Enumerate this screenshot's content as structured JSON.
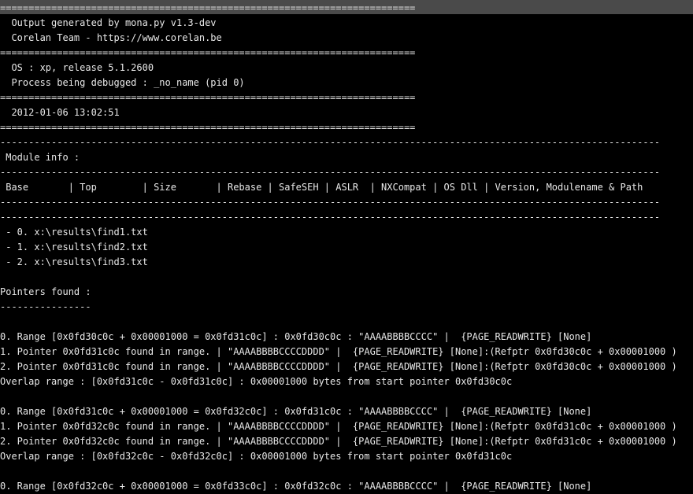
{
  "window": {
    "title": ""
  },
  "console": {
    "lines": [
      "=========================================================================",
      "  Output generated by mona.py v1.3-dev",
      "  Corelan Team - https://www.corelan.be",
      "=========================================================================",
      "  OS : xp, release 5.1.2600",
      "  Process being debugged : _no_name (pid 0)",
      "=========================================================================",
      "  2012-01-06 13:02:51",
      "=========================================================================",
      "--------------------------------------------------------------------------------------------------------------------",
      " Module info :",
      "--------------------------------------------------------------------------------------------------------------------",
      " Base       | Top        | Size       | Rebase | SafeSEH | ASLR  | NXCompat | OS Dll | Version, Modulename & Path",
      "--------------------------------------------------------------------------------------------------------------------",
      "--------------------------------------------------------------------------------------------------------------------",
      " - 0. x:\\results\\find1.txt",
      " - 1. x:\\results\\find2.txt",
      " - 2. x:\\results\\find3.txt",
      "",
      "Pointers found :",
      "----------------",
      "",
      "0. Range [0x0fd30c0c + 0x00001000 = 0x0fd31c0c] : 0x0fd30c0c : \"AAAABBBBCCCC\" |  {PAGE_READWRITE} [None]",
      "1. Pointer 0x0fd31c0c found in range. | \"AAAABBBBCCCCDDDD\" |  {PAGE_READWRITE} [None]:(Refptr 0x0fd30c0c + 0x00001000 )",
      "2. Pointer 0x0fd31c0c found in range. | \"AAAABBBBCCCCDDDD\" |  {PAGE_READWRITE} [None]:(Refptr 0x0fd30c0c + 0x00001000 )",
      "Overlap range : [0x0fd31c0c - 0x0fd31c0c] : 0x00001000 bytes from start pointer 0x0fd30c0c",
      "",
      "0. Range [0x0fd31c0c + 0x00001000 = 0x0fd32c0c] : 0x0fd31c0c : \"AAAABBBBCCCC\" |  {PAGE_READWRITE} [None]",
      "1. Pointer 0x0fd32c0c found in range. | \"AAAABBBBCCCCDDDD\" |  {PAGE_READWRITE} [None]:(Refptr 0x0fd31c0c + 0x00001000 )",
      "2. Pointer 0x0fd32c0c found in range. | \"AAAABBBBCCCCDDDD\" |  {PAGE_READWRITE} [None]:(Refptr 0x0fd31c0c + 0x00001000 )",
      "Overlap range : [0x0fd32c0c - 0x0fd32c0c] : 0x00001000 bytes from start pointer 0x0fd31c0c",
      "",
      "0. Range [0x0fd32c0c + 0x00001000 = 0x0fd33c0c] : 0x0fd32c0c : \"AAAABBBBCCCC\" |  {PAGE_READWRITE} [None]"
    ]
  },
  "colors": {
    "background": "#000000",
    "text": "#e8e8e8",
    "titlebar": "#4a4a4a"
  }
}
